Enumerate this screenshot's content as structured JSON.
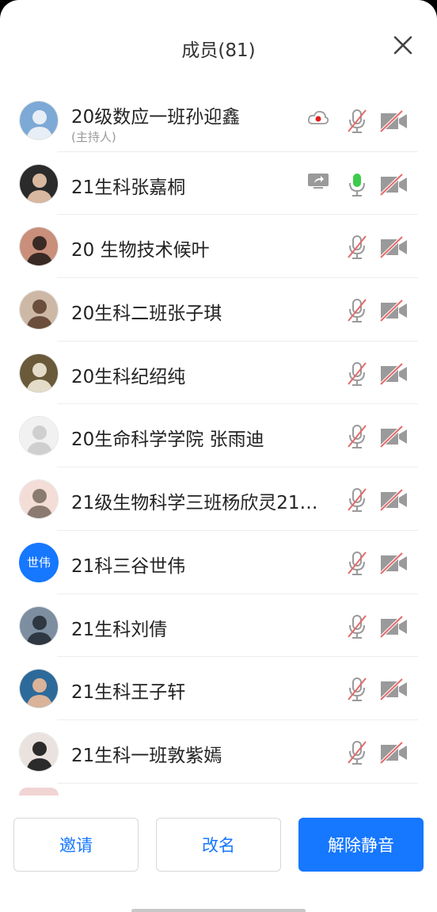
{
  "header": {
    "title": "成员(81)"
  },
  "members": [
    {
      "name": "20级数应一班孙迎鑫",
      "role": "(主持人)",
      "status_icon": "cloud-record-icon",
      "mic": "muted",
      "camera": "off",
      "avatar": {
        "type": "photo",
        "bg": "#7da9d6",
        "fg": "#e8eef5"
      }
    },
    {
      "name": "21生科张嘉桐",
      "status_icon": "screen-share-icon",
      "mic": "active",
      "camera": "off",
      "avatar": {
        "type": "photo",
        "bg": "#2b2b2b",
        "fg": "#d9b8a0"
      }
    },
    {
      "name": "20  生物技术候叶",
      "mic": "muted",
      "camera": "off",
      "avatar": {
        "type": "photo",
        "bg": "#c98f7a",
        "fg": "#3a2a26"
      }
    },
    {
      "name": "20生科二班张子琪",
      "mic": "muted",
      "camera": "off",
      "avatar": {
        "type": "photo",
        "bg": "#cdb8a6",
        "fg": "#6b4f3c"
      }
    },
    {
      "name": "20生科纪绍纯",
      "mic": "muted",
      "camera": "off",
      "avatar": {
        "type": "photo",
        "bg": "#6a5a3a",
        "fg": "#e4dcc8"
      }
    },
    {
      "name": "20生命科学学院  张雨迪",
      "mic": "muted",
      "camera": "off",
      "avatar": {
        "type": "photo",
        "bg": "#f1f1f1",
        "fg": "#cfcfcf"
      }
    },
    {
      "name": "21级生物科学三班杨欣灵21…",
      "mic": "muted",
      "camera": "off",
      "avatar": {
        "type": "photo",
        "bg": "#f3ddd6",
        "fg": "#8a7a70"
      }
    },
    {
      "name": "21科三谷世伟",
      "mic": "muted",
      "camera": "off",
      "avatar": {
        "type": "text",
        "text": "世伟",
        "bg": "#1677ff"
      }
    },
    {
      "name": "21生科刘倩",
      "mic": "muted",
      "camera": "off",
      "avatar": {
        "type": "photo",
        "bg": "#7c8ea0",
        "fg": "#2e3742"
      }
    },
    {
      "name": "21生科王子轩",
      "mic": "muted",
      "camera": "off",
      "avatar": {
        "type": "photo",
        "bg": "#2d6a9a",
        "fg": "#d9b39a"
      }
    },
    {
      "name": "21生科一班敦紫嫣",
      "mic": "muted",
      "camera": "off",
      "avatar": {
        "type": "photo",
        "bg": "#e9e2de",
        "fg": "#2b2b2b"
      }
    }
  ],
  "footer": {
    "invite_label": "邀请",
    "rename_label": "改名",
    "unmute_all_label": "解除静音"
  },
  "colors": {
    "accent": "#1677ff",
    "muted_slash": "#e46a6a",
    "mic_active": "#3ccb4a",
    "icon_gray": "#9a9a9a"
  }
}
